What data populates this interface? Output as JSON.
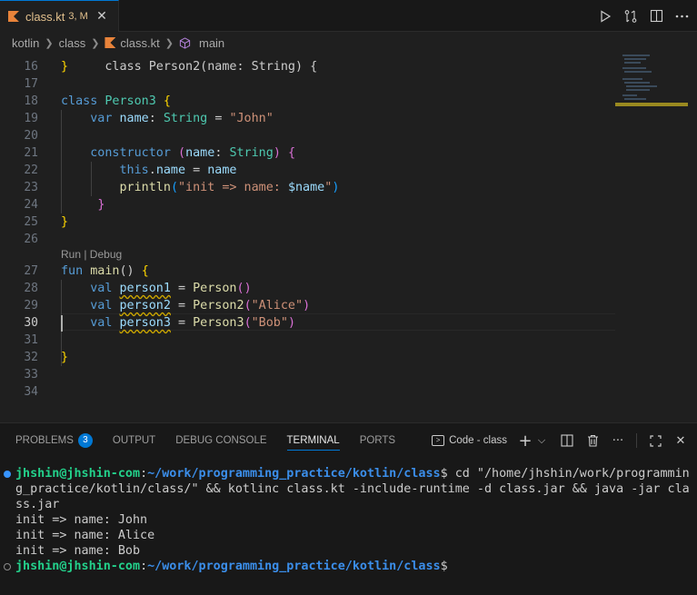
{
  "tab": {
    "file_name": "class.kt",
    "badge": "3, M",
    "close": "✕"
  },
  "breadcrumb": {
    "items": [
      "kotlin",
      "class",
      "class.kt",
      "main"
    ]
  },
  "editor": {
    "line_numbers": [
      "16",
      "17",
      "18",
      "19",
      "20",
      "21",
      "22",
      "23",
      "24",
      "25",
      "26",
      "27",
      "28",
      "29",
      "30",
      "31",
      "32",
      "33",
      "34"
    ],
    "active_line": "30",
    "code_lens": "Run | Debug",
    "code": {
      "l16_partial": "class Person2(name: String) {",
      "l16": "}",
      "l18": {
        "kw": "class",
        "name": "Person3",
        "brace": "{"
      },
      "l19": {
        "kw": "var",
        "name": "name",
        "colon": ":",
        "type": "String",
        "eq": "=",
        "value": "\"John\""
      },
      "l21": {
        "kw": "constructor",
        "open": "(",
        "param": "name",
        "colon": ":",
        "type": "String",
        "close": ")",
        "brace": "{"
      },
      "l22": {
        "kw": "this",
        "dot": ".",
        "prop": "name",
        "eq": "=",
        "value": "name"
      },
      "l23": {
        "fn": "println",
        "open": "(",
        "str": "\"init => name: ",
        "tmpl": "$name",
        "strend": "\"",
        "close": ")"
      },
      "l24": "}",
      "l25": "}",
      "l27": {
        "kw": "fun",
        "fn": "main",
        "parens": "()",
        "brace": "{"
      },
      "l28": {
        "kw": "val",
        "name": "person1",
        "eq": "=",
        "fn": "Person",
        "open": "(",
        "close": ")"
      },
      "l29": {
        "kw": "val",
        "name": "person2",
        "eq": "=",
        "fn": "Person2",
        "open": "(",
        "arg": "\"Alice\"",
        "close": ")"
      },
      "l30": {
        "kw": "val",
        "name": "person3",
        "eq": "=",
        "fn": "Person3",
        "open": "(",
        "arg": "\"Bob\"",
        "close": ")"
      },
      "l32": "}"
    }
  },
  "panel": {
    "tabs": [
      "PROBLEMS",
      "OUTPUT",
      "DEBUG CONSOLE",
      "TERMINAL",
      "PORTS"
    ],
    "problems_count": "3",
    "active_tab": "TERMINAL",
    "terminal_name": "Code - class",
    "add": "+",
    "chevron": "⌵",
    "more": "···",
    "maximize": "⛶",
    "close": "✕"
  },
  "terminal": {
    "prompt_user": "jhshin@jhshin-com",
    "prompt_sep": ":",
    "prompt_path": "~/work/programming_practice/kotlin/class",
    "prompt_end": "$",
    "command_1": " cd \"/home/jhshin/work/programmin",
    "command_2": "g_practice/kotlin/class/\" && kotlinc class.kt -include-runtime -d class.jar && java -jar cla",
    "command_3": "ss.jar",
    "output": [
      "init => name: John",
      "init => name: Alice",
      "init => name: Bob"
    ]
  },
  "colors": {
    "accent": "#0078d4",
    "modified": "#e2c08d",
    "terminal_user": "#23d18b",
    "terminal_path": "#3b8eea"
  }
}
